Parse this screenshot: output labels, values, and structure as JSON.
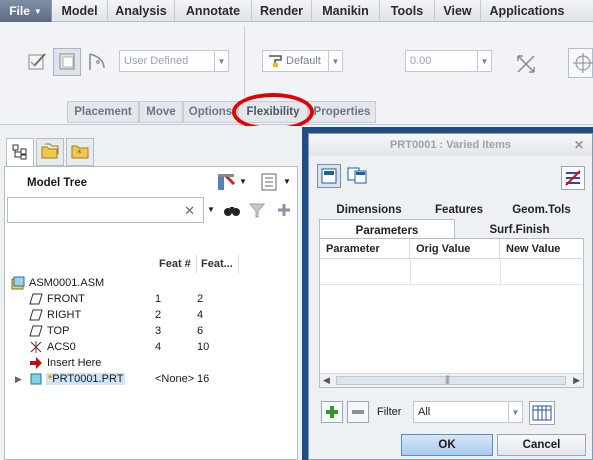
{
  "menubar": {
    "file_label": "File",
    "items": [
      "Model",
      "Analysis",
      "Annotate",
      "Render",
      "Manikin",
      "Tools",
      "View",
      "Applications"
    ]
  },
  "ribbon": {
    "user_defined": "User Defined",
    "default_label": "Default",
    "value": "0.00",
    "tabs": [
      "Placement",
      "Move",
      "Options",
      "Flexibility",
      "Properties"
    ]
  },
  "model_tree": {
    "title": "Model Tree",
    "columns": [
      "Feat #",
      "Feat..."
    ],
    "rows": [
      {
        "label": "ASM0001.ASM",
        "feat_num": "",
        "feat_id": "",
        "icon": "assembly-icon"
      },
      {
        "label": "FRONT",
        "feat_num": "1",
        "feat_id": "2",
        "icon": "datum-plane-icon"
      },
      {
        "label": "RIGHT",
        "feat_num": "2",
        "feat_id": "4",
        "icon": "datum-plane-icon"
      },
      {
        "label": "TOP",
        "feat_num": "3",
        "feat_id": "6",
        "icon": "datum-plane-icon"
      },
      {
        "label": "ACS0",
        "feat_num": "4",
        "feat_id": "10",
        "icon": "csys-icon"
      },
      {
        "label": "Insert Here",
        "feat_num": "",
        "feat_id": "",
        "icon": "insert-arrow-icon"
      },
      {
        "label": "PRT0001.PRT",
        "feat_num": "<None>",
        "feat_id": "16",
        "icon": "part-icon"
      }
    ]
  },
  "dialog": {
    "title": "PRT0001 : Varied Items",
    "tabs_row1": [
      "Dimensions",
      "Features",
      "Geom.Tols"
    ],
    "tabs_row2": [
      "Parameters",
      "Surf.Finish"
    ],
    "columns": [
      "Parameter",
      "Orig Value",
      "New Value"
    ],
    "filter_label": "Filter",
    "filter_value": "All",
    "ok_label": "OK",
    "cancel_label": "Cancel"
  },
  "colors": {
    "dialog_frame": "#1f4e86",
    "highlight": "#e00000",
    "add_green": "#2e9b2e"
  }
}
